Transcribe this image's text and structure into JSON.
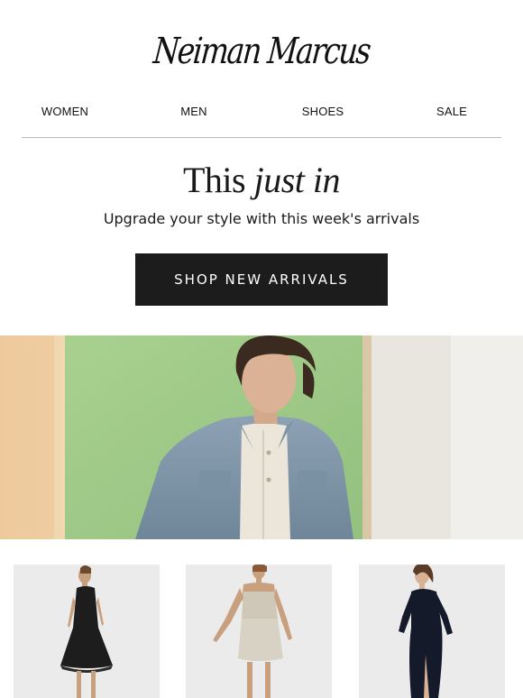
{
  "brand": {
    "logo_text": "Neiman Marcus"
  },
  "nav": {
    "items": [
      {
        "label": "WOMEN"
      },
      {
        "label": "MEN"
      },
      {
        "label": "SHOES"
      },
      {
        "label": "SALE"
      }
    ]
  },
  "promo": {
    "headline_regular": "This",
    "headline_italic": "just in",
    "subhead": "Upgrade your style with this week's arrivals",
    "cta_label": "SHOP NEW ARRIVALS"
  },
  "colors": {
    "cta_background": "#1c1c1c",
    "divider": "#b9b9b9",
    "hero_green": "#9fc98a"
  },
  "products": [
    {
      "image": "black-lace-sleeveless-dress"
    },
    {
      "image": "metallic-silver-mini-dress"
    },
    {
      "image": "black-long-sleeve-gown"
    }
  ]
}
